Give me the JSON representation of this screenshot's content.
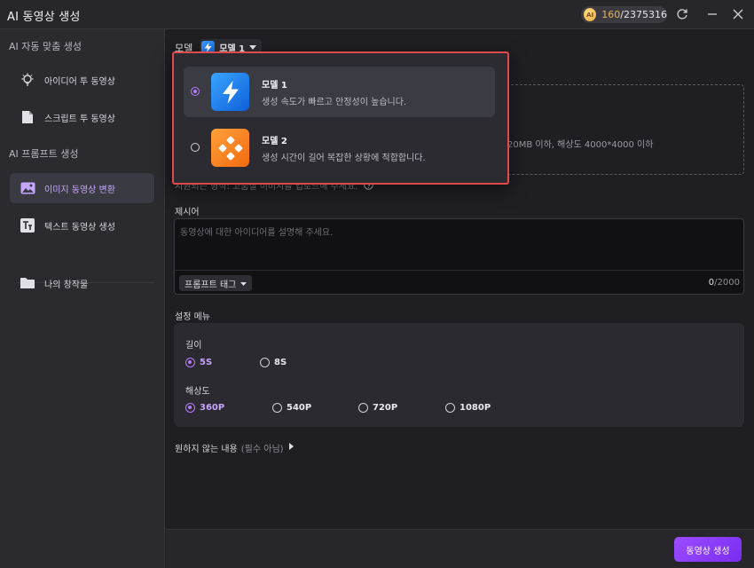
{
  "app": {
    "title": "AI 동영상 생성"
  },
  "credits": {
    "coin_label": "AI",
    "used": "160",
    "total": "/2375316"
  },
  "sidebar": {
    "section1": "AI 자동 맞춤 생성",
    "section2": "AI 프롬프트 생성",
    "items": [
      {
        "label": "아이디어 투 동영상",
        "icon": "lightbulb-icon"
      },
      {
        "label": "스크립트 투 동영상",
        "icon": "document-icon"
      },
      {
        "label": "이미지 동영상 변환",
        "icon": "image-icon"
      },
      {
        "label": "텍스트 동영상 생성",
        "icon": "text-icon"
      },
      {
        "label": "나의 창작물",
        "icon": "folder-icon"
      }
    ]
  },
  "main": {
    "model_label": "모델",
    "model_selected": "모델 1",
    "upload_hint": "20MB 이하, 해상도 4000*4000 이하",
    "upload_note": "지원되는 형식: 고품질 이미지를 업로드해 주세요.",
    "prompt_label": "제시어",
    "prompt_placeholder": "동영상에 대한 아이디어를 설명해 주세요.",
    "prompt_tag_button": "프롬프트 태그",
    "prompt_count_current": "0",
    "prompt_count_max": "/2000",
    "settings_label": "설정 메뉴",
    "length_label": "길이",
    "length_options": [
      "5S",
      "8S"
    ],
    "resolution_label": "해상도",
    "resolution_options": [
      "360P",
      "540P",
      "720P",
      "1080P"
    ],
    "negative_label": "원하지 않는 내용",
    "negative_optional": "(필수 아님)",
    "generate_button": "동영상 생성"
  },
  "dropdown": {
    "items": [
      {
        "title": "모델 1",
        "desc": "생성 속도가 빠르고 안정성이 높습니다.",
        "selected": true
      },
      {
        "title": "모델 2",
        "desc": "생성 시간이 길어 복잡한 상황에 적합합니다.",
        "selected": false
      }
    ]
  },
  "colors": {
    "accent": "#b57bff",
    "highlight_border": "#e04a4a",
    "credits_used": "#e5b25a"
  }
}
